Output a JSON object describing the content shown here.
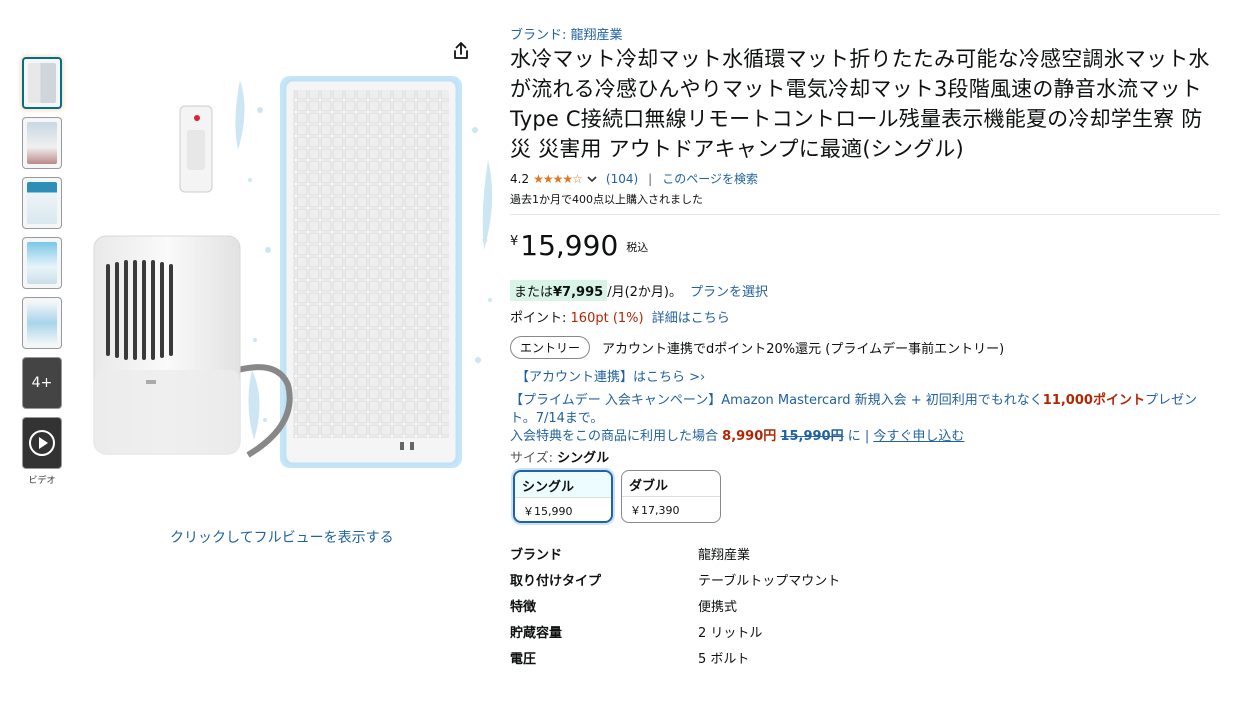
{
  "brand_line": "ブランド: 龍翔産業",
  "title": "水冷マット冷却マット水循環マット折りたたみ可能な冷感空調氷マット水が流れる冷感ひんやりマット電気冷却マット3段階風速の静音水流マットType C接続口無線リモートコントロール残量表示機能夏の冷却学生寮 防災 災害用 アウトドアキャンプに最適(シングル)",
  "rating": {
    "value": "4.2",
    "stars": "★★★★☆",
    "count": "(104)",
    "separator": "|",
    "search_link": "このページを検索"
  },
  "bought_text": "過去1か月で400点以上購入されました",
  "price": {
    "symbol": "¥",
    "amount": "15,990",
    "tax": "税込"
  },
  "installment": {
    "prefix": "または",
    "amount": "¥7,995",
    "suffix": "/月(2か月)。",
    "plan_link": "プランを選択"
  },
  "points": {
    "label": "ポイント:",
    "value": "160pt  (1%)",
    "detail_link": "詳細はこちら"
  },
  "promo": {
    "entry_button": "エントリー",
    "text": "アカウント連携でdポイント20%還元 (プライムデー事前エントリー)",
    "link": "【アカウント連携】はこちら >›"
  },
  "campaign": {
    "text_before": "【プライムデー 入会キャンペーン】Amazon Mastercard 新規入会 + 初回利用でもれなく",
    "highlight": "11,000ポイント",
    "text_after": "プレゼント。7/14まで。"
  },
  "member": {
    "prefix": "入会特典をこの商品に利用した場合",
    "discount_price": "8,990円",
    "original_price": "15,990円",
    "middle": "に |",
    "apply_link": "今すぐ申し込む"
  },
  "size": {
    "label": "サイズ:",
    "value": "シングル"
  },
  "swatches": [
    {
      "name": "シングル",
      "price": "￥15,990"
    },
    {
      "name": "ダブル",
      "price": "￥17,390"
    }
  ],
  "specs": [
    {
      "key": "ブランド",
      "value": "龍翔産業"
    },
    {
      "key": "取り付けタイプ",
      "value": "テーブルトップマウント"
    },
    {
      "key": "特徴",
      "value": "便携式"
    },
    {
      "key": "貯蔵容量",
      "value": "2 リットル"
    },
    {
      "key": "電圧",
      "value": "5 ボルト"
    }
  ],
  "thumbnails": {
    "more_label": "4+",
    "video_label": "ビデオ"
  },
  "fullview_link": "クリックしてフルビューを表示する",
  "icons": {
    "share": "share-icon",
    "play": "play-icon",
    "chevron": "chevron-down-icon"
  },
  "colors": {
    "link": "#2162a1",
    "price_red": "#b12704",
    "star": "#de7921",
    "mat_glow": "#7ec8f0"
  }
}
